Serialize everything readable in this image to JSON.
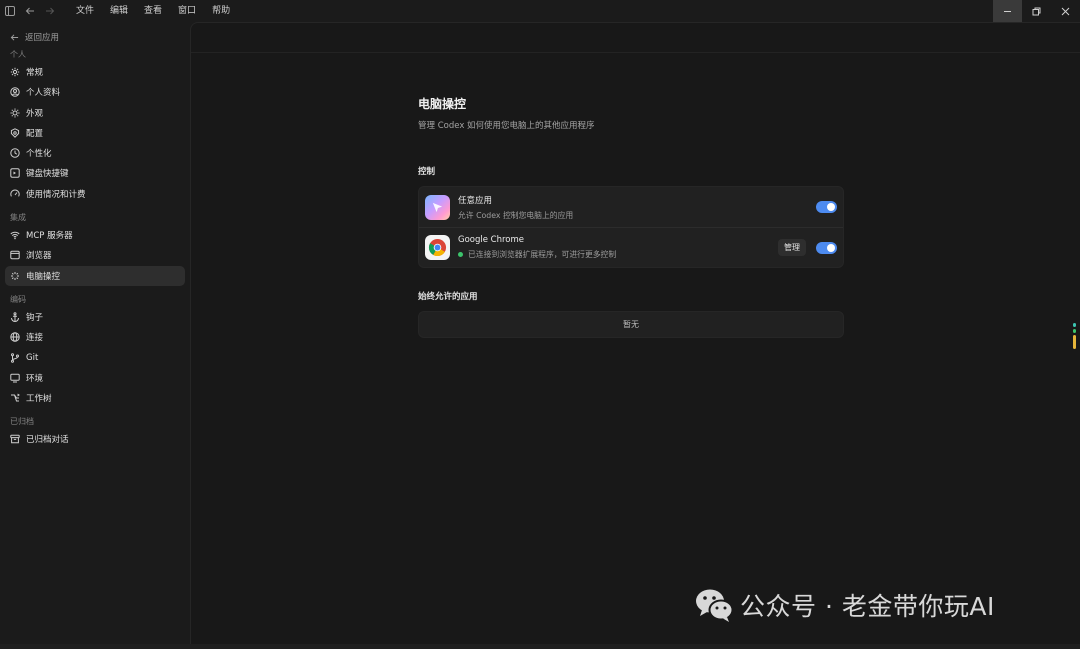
{
  "titlebar": {
    "menu": [
      "文件",
      "编辑",
      "查看",
      "窗口",
      "帮助"
    ]
  },
  "sidebar": {
    "back_label": "返回应用",
    "sections": [
      {
        "label": "个人",
        "items": [
          {
            "label": "常规",
            "icon": "gear-icon"
          },
          {
            "label": "个人资料",
            "icon": "user-circle-icon"
          },
          {
            "label": "外观",
            "icon": "sun-icon"
          },
          {
            "label": "配置",
            "icon": "shield-icon"
          },
          {
            "label": "个性化",
            "icon": "clock-icon"
          },
          {
            "label": "键盘快捷键",
            "icon": "keyboard-icon"
          },
          {
            "label": "使用情况和计费",
            "icon": "gauge-icon"
          }
        ]
      },
      {
        "label": "集成",
        "items": [
          {
            "label": "MCP 服务器",
            "icon": "wifi-icon"
          },
          {
            "label": "浏览器",
            "icon": "browser-icon"
          },
          {
            "label": "电脑操控",
            "icon": "sparkle-icon",
            "active": true
          }
        ]
      },
      {
        "label": "编码",
        "items": [
          {
            "label": "钩子",
            "icon": "anchor-icon"
          },
          {
            "label": "连接",
            "icon": "globe-icon"
          },
          {
            "label": "Git",
            "icon": "git-branch-icon"
          },
          {
            "label": "环境",
            "icon": "monitor-icon"
          },
          {
            "label": "工作树",
            "icon": "tree-icon"
          }
        ]
      },
      {
        "label": "已归档",
        "items": [
          {
            "label": "已归档对话",
            "icon": "archive-icon"
          }
        ]
      }
    ]
  },
  "main": {
    "title": "电脑操控",
    "subtitle": "管理 Codex 如何使用您电脑上的其他应用程序",
    "control_section": "控制",
    "apps": [
      {
        "name": "任意应用",
        "desc": "允许 Codex 控制您电脑上的应用",
        "icon": "any-app-icon",
        "enabled": true
      },
      {
        "name": "Google Chrome",
        "desc": "已连接到浏览器扩展程序，可进行更多控制",
        "icon": "chrome-icon",
        "connected": true,
        "manage_label": "管理",
        "enabled": true
      }
    ],
    "allowed_section": "始终允许的应用",
    "empty_label": "暂无"
  },
  "watermark": {
    "text": "公众号 · 老金带你玩AI"
  },
  "colors": {
    "accent": "#4d8bf0",
    "connected": "#3cc46b",
    "background": "#181818",
    "sidebar": "#1b1b1b"
  }
}
